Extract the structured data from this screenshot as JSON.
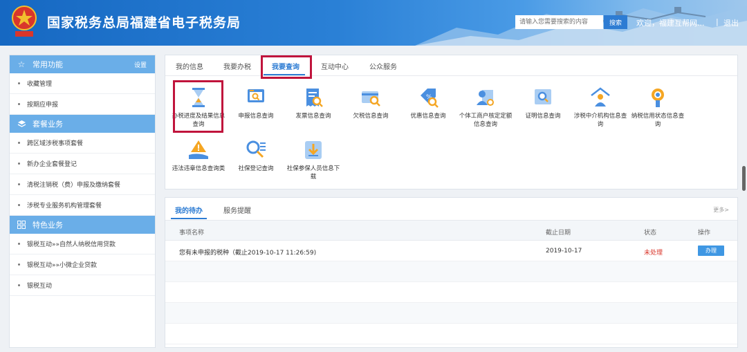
{
  "header": {
    "title": "国家税务总局福建省电子税务局",
    "search_placeholder": "请输入您需要搜索的内容",
    "search_button": "搜索",
    "welcome": "欢迎，福建互帮网...",
    "separator": "|",
    "logout": "退出"
  },
  "sidebar": {
    "sections": [
      {
        "title": "常用功能",
        "icon": "star-icon",
        "action": "设置",
        "items": [
          "收藏管理",
          "按期应申报"
        ]
      },
      {
        "title": "套餐业务",
        "icon": "layers-icon",
        "items": [
          "跨区域涉税事项套餐",
          "新办企业套餐登记",
          "清税注销税（费）申报及缴纳套餐",
          "涉税专业服务机构管理套餐"
        ]
      },
      {
        "title": "特色业务",
        "icon": "grid-icon",
        "items": [
          "银税互动»»自然人纳税信用贷款",
          "银税互动»»小微企业贷款",
          "银税互动"
        ]
      }
    ]
  },
  "tabs": [
    "我的信息",
    "我要办税",
    "我要查询",
    "互动中心",
    "公众服务"
  ],
  "active_tab": "我要查询",
  "functions": [
    {
      "label": "办税进度及结果信息查询",
      "icon": "hourglass-icon"
    },
    {
      "label": "申报信息查询",
      "icon": "monitor-search-icon"
    },
    {
      "label": "发票信息查询",
      "icon": "invoice-search-icon"
    },
    {
      "label": "欠税信息查询",
      "icon": "card-search-icon"
    },
    {
      "label": "优惠信息查询",
      "icon": "discount-tag-icon"
    },
    {
      "label": "个体工商户核定定额信息查询",
      "icon": "person-doc-icon"
    },
    {
      "label": "证明信息查询",
      "icon": "certificate-search-icon"
    },
    {
      "label": "涉税中介机构信息查询",
      "icon": "house-person-icon"
    },
    {
      "label": "纳税信用状态信息查询",
      "icon": "medal-icon"
    },
    {
      "label": "违法违章信息查询类",
      "icon": "warning-hand-icon"
    },
    {
      "label": "社保登记查询",
      "icon": "list-search-icon"
    },
    {
      "label": "社保参保人员信息下载",
      "icon": "download-icon"
    }
  ],
  "todo": {
    "tabs": [
      "我的待办",
      "服务提醒"
    ],
    "more": "更多>",
    "columns": [
      "事项名称",
      "截止日期",
      "状态",
      "操作"
    ],
    "rows": [
      {
        "name": "您有未申报的税种（截止2019-10-17 11:26:59)",
        "deadline": "2019-10-17",
        "status": "未处理",
        "action": "办理"
      }
    ]
  },
  "colors": {
    "brand_blue": "#2d7cd3",
    "sidebar_head": "#6aaee8",
    "highlight_red": "#c0143c",
    "status_red": "#d9362b"
  }
}
